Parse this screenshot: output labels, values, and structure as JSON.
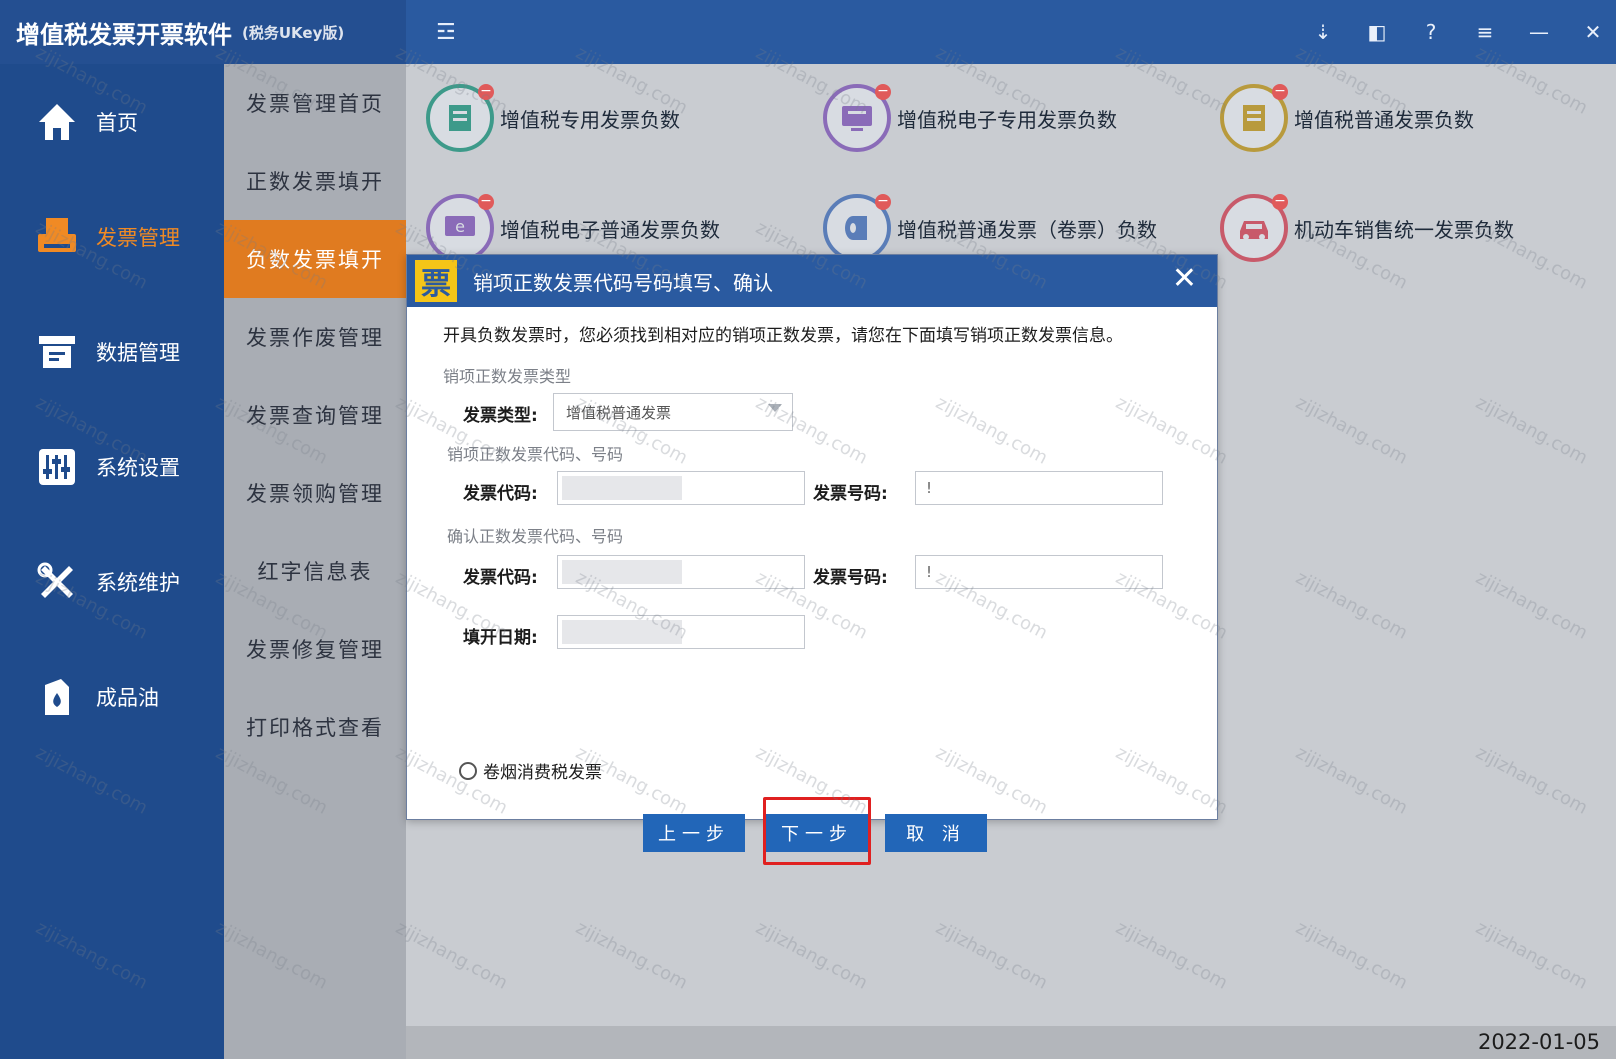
{
  "app": {
    "title": "增值税发票开票软件",
    "subtitle": "(税务UKey版)",
    "menu_toggle": "☲",
    "window_controls": [
      {
        "name": "pin-icon",
        "glyph": "⇣"
      },
      {
        "name": "restore-icon",
        "glyph": "◧"
      },
      {
        "name": "help-icon",
        "glyph": "?"
      },
      {
        "name": "menu-icon",
        "glyph": "≡"
      },
      {
        "name": "minimize-icon",
        "glyph": "—"
      },
      {
        "name": "close-icon",
        "glyph": "✕"
      }
    ]
  },
  "leftnav": {
    "items": [
      {
        "label": "首页",
        "icon": "home-icon",
        "active": false
      },
      {
        "label": "发票管理",
        "icon": "invoice-printer-icon",
        "active": true
      },
      {
        "label": "数据管理",
        "icon": "data-management-icon",
        "active": false
      },
      {
        "label": "系统设置",
        "icon": "settings-sliders-icon",
        "active": false
      },
      {
        "label": "系统维护",
        "icon": "tools-icon",
        "active": false
      },
      {
        "label": "成品油",
        "icon": "oil-can-icon",
        "active": false
      }
    ]
  },
  "subnav": {
    "items": [
      {
        "label": "发票管理首页",
        "active": false
      },
      {
        "label": "正数发票填开",
        "active": false
      },
      {
        "label": "负数发票填开",
        "active": true
      },
      {
        "label": "发票作废管理",
        "active": false
      },
      {
        "label": "发票查询管理",
        "active": false
      },
      {
        "label": "发票领购管理",
        "active": false
      },
      {
        "label": "红字信息表",
        "active": false
      },
      {
        "label": "发票修复管理",
        "active": false
      },
      {
        "label": "打印格式查看",
        "active": false
      }
    ]
  },
  "main": {
    "cards": [
      {
        "label": "增值税专用发票负数",
        "color": "#3d9a8a"
      },
      {
        "label": "增值税电子专用发票负数",
        "color": "#8a6bb8"
      },
      {
        "label": "增值税普通发票负数",
        "color": "#b89a3d"
      },
      {
        "label": "增值税电子普通发票负数",
        "color": "#8a6bb8"
      },
      {
        "label": "增值税普通发票（卷票）负数",
        "color": "#5a7db8"
      },
      {
        "label": "机动车销售统一发票负数",
        "color": "#c85a6a"
      }
    ]
  },
  "dialog": {
    "title_icon": "票",
    "title": "销项正数发票代码号码填写、确认",
    "notice": "开具负数发票时，您必须找到相对应的销项正数发票，请您在下面填写销项正数发票信息。",
    "section_type": "销项正数发票类型",
    "invoice_type_label": "发票类型:",
    "invoice_type_value": "增值税普通发票",
    "section_code": "销项正数发票代码、号码",
    "section_confirm": "确认正数发票代码、号码",
    "code_label": "发票代码:",
    "number_label": "发票号码:",
    "date_label": "填开日期:",
    "number_prefix": "!",
    "tobacco_label": "卷烟消费税发票",
    "btn_prev": "上一步",
    "btn_next": "下一步",
    "btn_cancel": "取 消"
  },
  "status": {
    "date": "2022-01-05"
  },
  "watermark": "zijizhang.com"
}
